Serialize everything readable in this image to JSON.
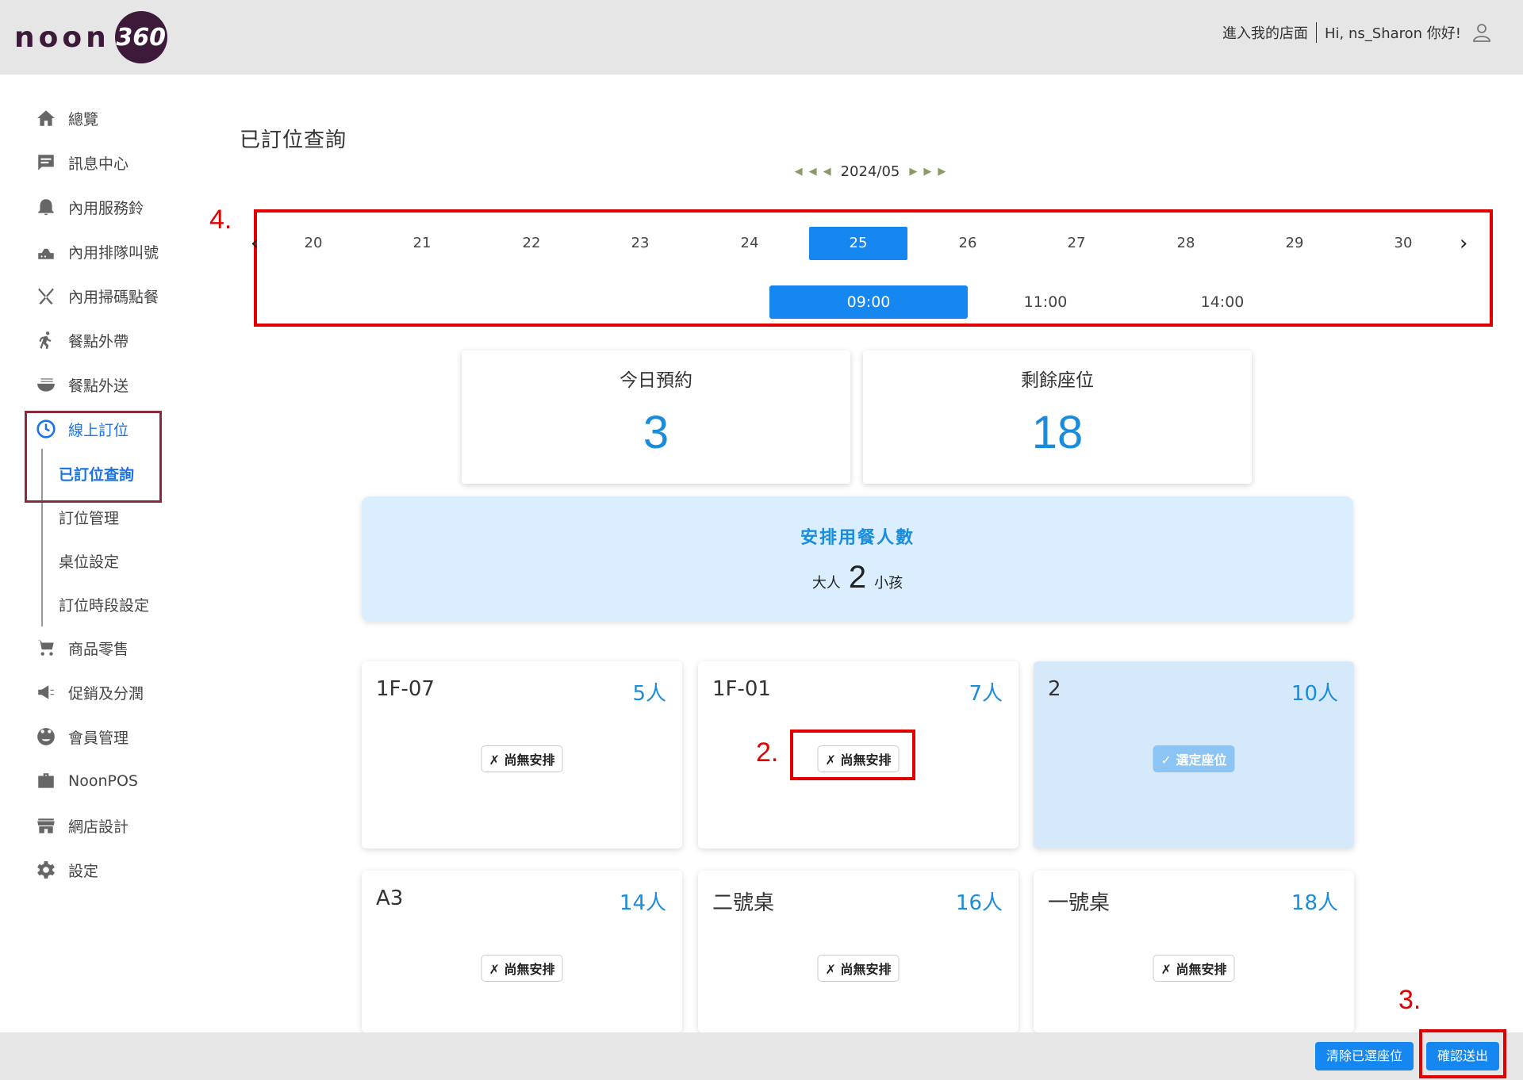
{
  "header": {
    "logo_text": "noon",
    "logo_badge": "360",
    "store_link": "進入我的店面",
    "greeting": "Hi, ns_Sharon 你好!"
  },
  "sidebar": {
    "items": [
      {
        "label": "總覽",
        "icon": "home-icon"
      },
      {
        "label": "訊息中心",
        "icon": "message-icon"
      },
      {
        "label": "內用服務鈴",
        "icon": "bell-icon"
      },
      {
        "label": "內用排隊叫號",
        "icon": "queue-icon"
      },
      {
        "label": "內用掃碼點餐",
        "icon": "utensils-icon"
      },
      {
        "label": "餐點外帶",
        "icon": "run-icon"
      },
      {
        "label": "餐點外送",
        "icon": "bowl-icon"
      },
      {
        "label": "線上訂位",
        "icon": "clock-icon"
      },
      {
        "label": "商品零售",
        "icon": "cart-icon"
      },
      {
        "label": "促銷及分潤",
        "icon": "megaphone-icon"
      },
      {
        "label": "會員管理",
        "icon": "member-icon"
      },
      {
        "label": "NoonPOS",
        "icon": "briefcase-icon"
      },
      {
        "label": "網店設計",
        "icon": "store-icon"
      },
      {
        "label": "設定",
        "icon": "gear-icon"
      }
    ],
    "sub_items": [
      "已訂位查詢",
      "訂位管理",
      "桌位設定",
      "訂位時段設定"
    ]
  },
  "main": {
    "title": "已訂位查詢",
    "month": "2024/05",
    "days": [
      "20",
      "21",
      "22",
      "23",
      "24",
      "25",
      "26",
      "27",
      "28",
      "29",
      "30"
    ],
    "selected_day": "25",
    "times": [
      "09:00",
      "11:00",
      "14:00"
    ],
    "selected_time": "09:00",
    "stats": {
      "today_label": "今日預約",
      "today_value": "3",
      "remain_label": "剩餘座位",
      "remain_value": "18"
    },
    "guests": {
      "title": "安排用餐人數",
      "adult_label": "大人",
      "count": "2",
      "child_label": "小孩"
    },
    "tables": [
      {
        "name": "1F-07",
        "capacity": "5人",
        "status": "✗ 尚無安排",
        "selected": false
      },
      {
        "name": "1F-01",
        "capacity": "7人",
        "status": "✗ 尚無安排",
        "selected": false
      },
      {
        "name": "2",
        "capacity": "10人",
        "status": "✓ 選定座位",
        "selected": true
      },
      {
        "name": "A3",
        "capacity": "14人",
        "status": "✗ 尚無安排",
        "selected": false
      },
      {
        "name": "二號桌",
        "capacity": "16人",
        "status": "✗ 尚無安排",
        "selected": false
      },
      {
        "name": "一號桌",
        "capacity": "18人",
        "status": "✗ 尚無安排",
        "selected": false
      }
    ]
  },
  "annotations": {
    "a2": "2.",
    "a3": "3.",
    "a4": "4."
  },
  "footer": {
    "clear_label": "清除已選座位",
    "confirm_label": "確認送出"
  },
  "colors": {
    "accent": "#1687f0",
    "highlight": "#e00000",
    "brand": "#3d1a3a"
  }
}
